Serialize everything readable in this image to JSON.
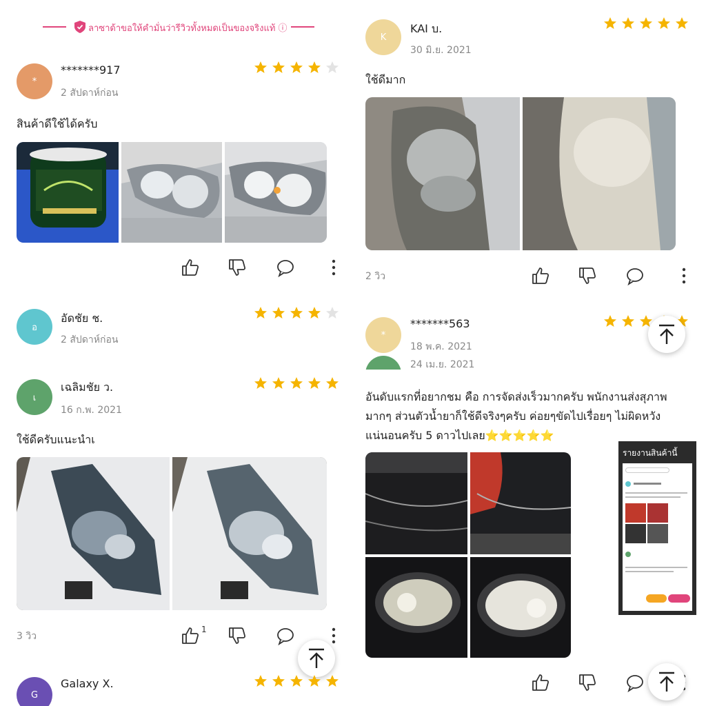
{
  "banner": {
    "text": "ลาซาด้าขอให้คำมั่นว่ารีวิวทั้งหมดเป็นของจริงแท้ ⓘ",
    "accent": "#e0457b"
  },
  "colors": {
    "star": "#f5b400",
    "star_empty": "#e3e3e3"
  },
  "left": {
    "reviews": [
      {
        "avatar": "*",
        "avatar_color": "#e49a68",
        "name": "*******917",
        "date": "2 สัปดาห์ก่อน",
        "rating": 4,
        "text": "สินค้าดีใช้ได้ครับ"
      },
      {
        "avatar": "อ",
        "avatar_color": "#5fc6cf",
        "name": "อัดชัย ช.",
        "date": "2 สัปดาห์ก่อน",
        "rating": 4
      },
      {
        "avatar": "เ",
        "avatar_color": "#5ea36b",
        "name": "เฉลิมชัย ว.",
        "date": "16 ก.พ. 2021",
        "rating": 5,
        "text": "ใช้ดีครับแนะนำเ",
        "views": "3 วิว",
        "like_count": "1"
      },
      {
        "avatar": "G",
        "avatar_color": "#6a4fb3",
        "name": "Galaxy X.",
        "rating": 5
      }
    ]
  },
  "right": {
    "reviews": [
      {
        "avatar": "K",
        "avatar_color": "#efd79a",
        "name": "KAI บ.",
        "date": "30 มิ.ย. 2021",
        "rating": 5,
        "text": "ใช้ดีมาก",
        "views": "2 วิว"
      },
      {
        "avatar": "*",
        "avatar_color": "#efd79a",
        "name": "*******563",
        "date": "18 พ.ค. 2021",
        "date2": "24 เม.ย. 2021",
        "rating": 5,
        "text": [
          "อันดับแรกที่อยากชม คือ การจัดส่งเร็วมากครับ พนักงานส่งสุภาพ",
          "มากๆ ส่วนตัวน้ำยาก็ใช้ดีจริงๆครับ ค่อยๆขัดไปเรื่อยๆ ไม่ผิดหวัง",
          "แน่นอนครับ 5 ดาวไปเลย⭐⭐⭐⭐⭐"
        ]
      }
    ],
    "report_label": "รายงานสินค้านี้"
  }
}
